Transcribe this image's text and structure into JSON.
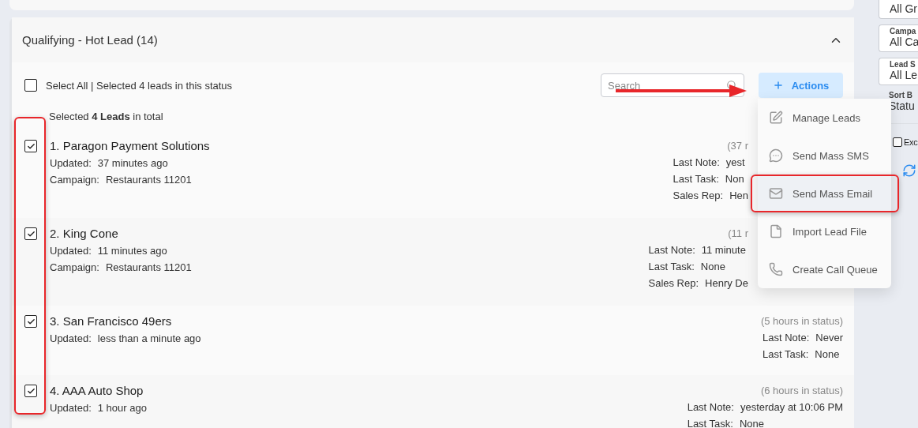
{
  "status_group": {
    "title": "Qualifying - Hot Lead (14)",
    "expanded": true,
    "select_all": {
      "label": "Select All | Selected 4 leads in this status",
      "checked": false
    },
    "summary": "Selected **4 Leads** in total",
    "search": {
      "placeholder": "Search"
    },
    "actions_button": "Actions",
    "leads": [
      {
        "title": "1. Paragon Payment Solutions",
        "checked": true,
        "details": [
          {
            "label": "Updated:",
            "value": "37 minutes ago"
          },
          {
            "label": "Campaign:",
            "value": "Restaurants 11201"
          }
        ],
        "status_time": "(37 r",
        "info": [
          {
            "label": "Last Note:",
            "value": "yest"
          },
          {
            "label": "Last Task:",
            "value": "Non"
          },
          {
            "label": "Sales Rep:",
            "value": "Hen"
          }
        ]
      },
      {
        "title": "2. King Cone",
        "checked": true,
        "details": [
          {
            "label": "Updated:",
            "value": "11 minutes ago"
          },
          {
            "label": "Campaign:",
            "value": "Restaurants 11201"
          }
        ],
        "status_time": "(11 r",
        "info": [
          {
            "label": "Last Note:",
            "value": "11 minute"
          },
          {
            "label": "Last Task:",
            "value": "None"
          },
          {
            "label": "Sales Rep:",
            "value": "Henry De"
          }
        ]
      },
      {
        "title": "3. San Francisco 49ers",
        "checked": true,
        "details": [
          {
            "label": "Updated:",
            "value": "less than a minute ago"
          }
        ],
        "status_time": "(5 hours in status)",
        "info": [
          {
            "label": "Last Note:",
            "value": "Never"
          },
          {
            "label": "Last Task:",
            "value": "None"
          }
        ]
      },
      {
        "title": "4. AAA Auto Shop",
        "checked": true,
        "details": [
          {
            "label": "Updated:",
            "value": "1 hour ago"
          }
        ],
        "status_time": "(6 hours in status)",
        "info": [
          {
            "label": "Last Note:",
            "value": "yesterday at 10:06 PM"
          },
          {
            "label": "Last Task:",
            "value": "None"
          }
        ]
      }
    ]
  },
  "actions_menu": [
    {
      "kind": "edit",
      "label": "Manage Leads",
      "selected": false
    },
    {
      "kind": "sms",
      "label": "Send Mass SMS",
      "selected": false
    },
    {
      "kind": "email",
      "label": "Send Mass Email",
      "selected": true
    },
    {
      "kind": "file",
      "label": "Import Lead File",
      "selected": false
    },
    {
      "kind": "phone",
      "label": "Create Call Queue",
      "selected": false
    }
  ],
  "filters": [
    {
      "value": "All Gr"
    },
    {
      "label": "Campa",
      "value": "All Ca"
    },
    {
      "label": "Lead S",
      "value": "All Le"
    }
  ],
  "sort": {
    "label": "Sort B",
    "value": "Statu"
  },
  "exclude": {
    "label": "Exc",
    "checked": false
  }
}
